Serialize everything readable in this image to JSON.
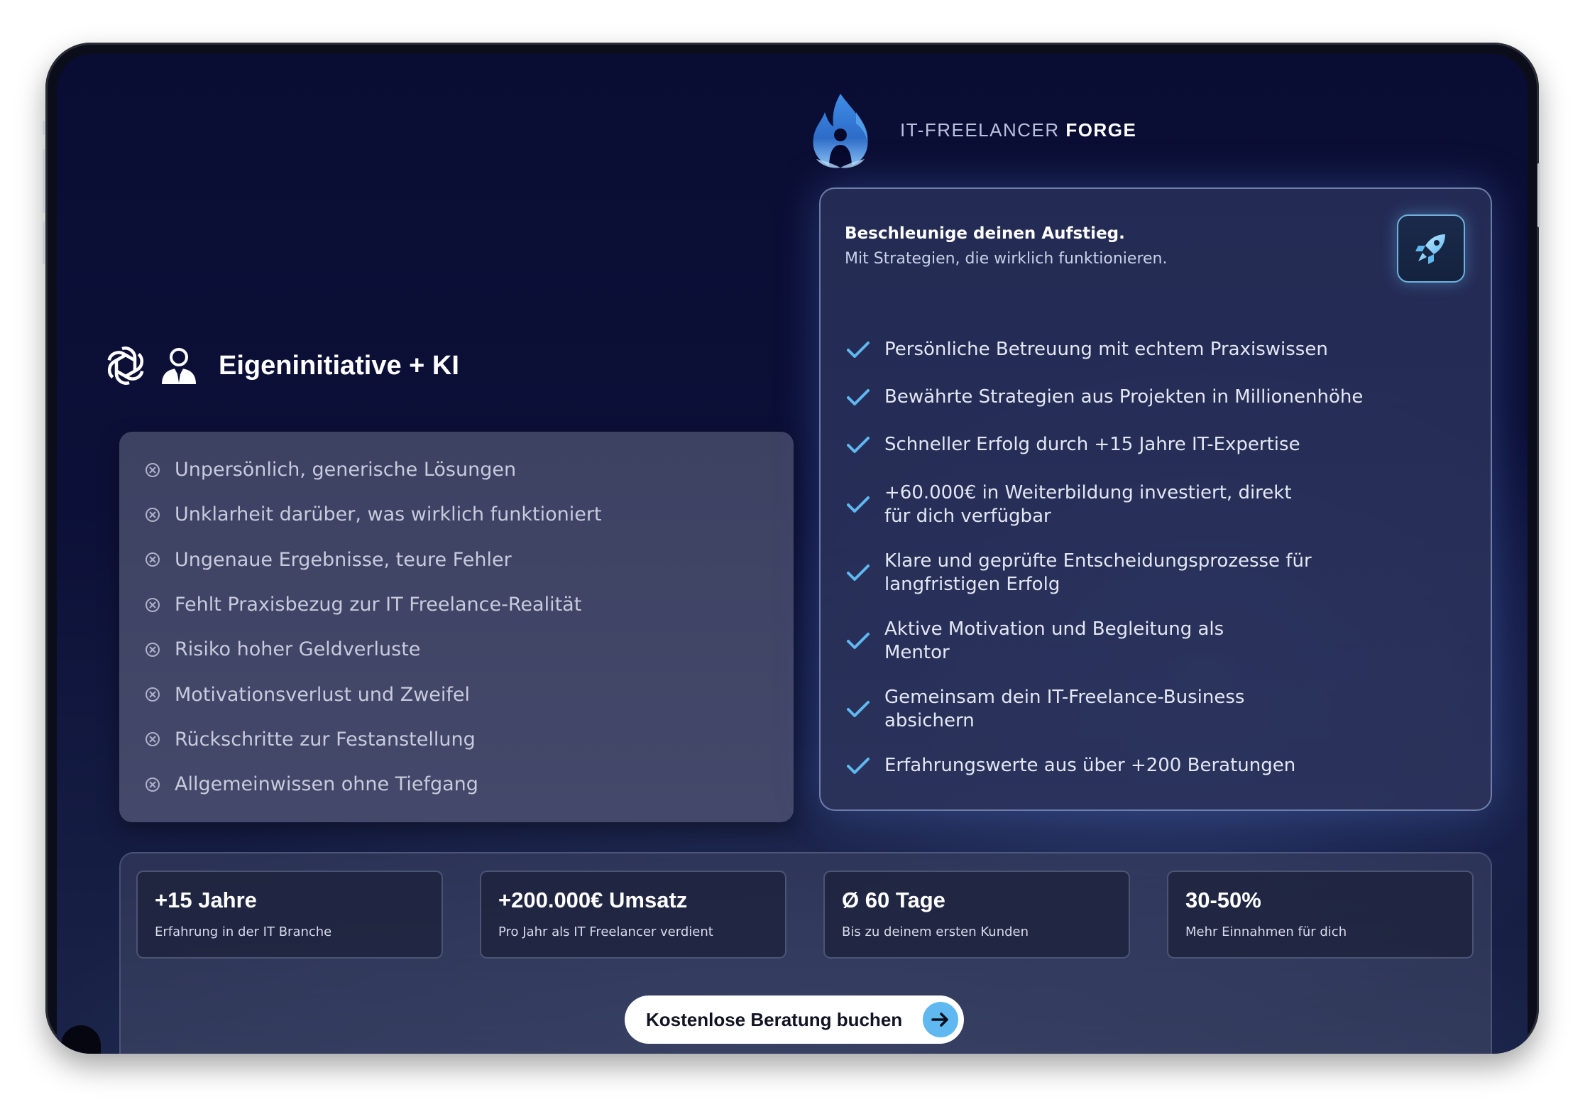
{
  "brand": {
    "name_light": "IT-FREELANCER ",
    "name_bold": "FORGE"
  },
  "left": {
    "heading": "Eigeninitiative + KI",
    "items": [
      "Unpersönlich, generische Lösungen",
      "Unklarheit darüber, was wirklich funktioniert",
      "Ungenaue Ergebnisse, teure Fehler",
      "Fehlt Praxisbezug zur IT Freelance-Realität",
      "Risiko hoher Geldverluste",
      "Motivationsverlust und Zweifel",
      "Rückschritte zur Festanstellung",
      "Allgemeinwissen ohne Tiefgang"
    ]
  },
  "right": {
    "title": "Beschleunige deinen Aufstieg.",
    "subtitle": "Mit Strategien, die wirklich funktionieren.",
    "items": [
      [
        "Persönliche Betreuung mit echtem Praxiswissen"
      ],
      [
        "Bewährte Strategien aus Projekten in Millionenhöhe"
      ],
      [
        "Schneller Erfolg durch +15 Jahre IT-Expertise"
      ],
      [
        "+60.000€ in Weiterbildung investiert, direkt",
        "für dich verfügbar"
      ],
      [
        "Klare und geprüfte Entscheidungsprozesse für",
        "langfristigen Erfolg"
      ],
      [
        "Aktive Motivation und Begleitung als",
        "Mentor"
      ],
      [
        "Gemeinsam dein IT-Freelance-Business",
        "absichern"
      ],
      [
        "Erfahrungswerte aus über +200 Beratungen"
      ]
    ]
  },
  "stats": [
    {
      "value": "+15 Jahre",
      "label": "Erfahrung in der IT Branche"
    },
    {
      "value": "+200.000€ Umsatz",
      "label": "Pro Jahr als IT Freelancer verdient"
    },
    {
      "value": "Ø 60 Tage",
      "label": "Bis zu deinem ersten Kunden"
    },
    {
      "value": "30-50%",
      "label": "Mehr Einnahmen für dich"
    }
  ],
  "cta": {
    "label": "Kostenlose Beratung buchen"
  },
  "icons": {
    "brand": "flame-person-logo-icon",
    "ai": "openai-logo-icon",
    "person": "person-icon",
    "cross": "circle-x-icon",
    "check": "check-icon",
    "rocket": "rocket-icon",
    "arrow": "arrow-right-icon"
  },
  "colors": {
    "accent": "#5fb8f0",
    "background": "#0a0d33",
    "card_border": "#aabeeb"
  }
}
